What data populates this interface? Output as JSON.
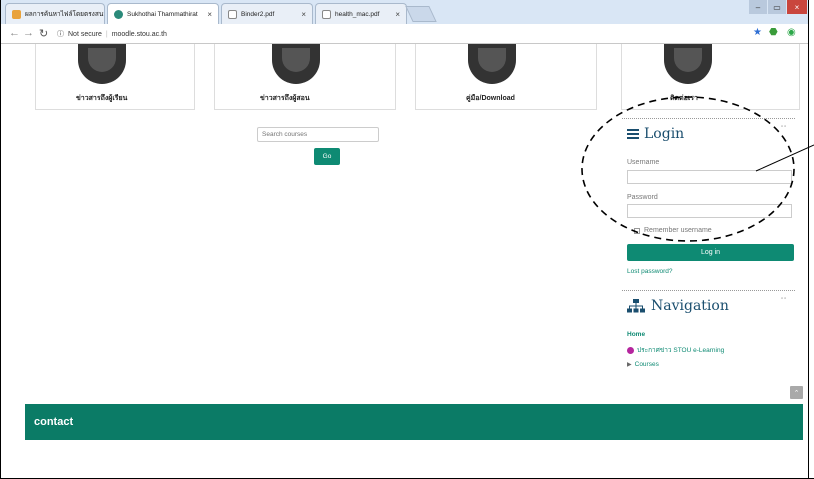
{
  "browser": {
    "tabs": [
      {
        "label": "ผลการค้นหาไฟล์โดยตรงสนามบิน"
      },
      {
        "label": "Sukhothai Thammathirat"
      },
      {
        "label": "Binder2.pdf"
      },
      {
        "label": "health_mac.pdf"
      }
    ],
    "address": {
      "security": "Not secure",
      "url": "moodle.stou.ac.th"
    },
    "icons": {
      "back": "back-arrow-icon",
      "forward": "forward-arrow-icon",
      "reload": "reload-icon",
      "info": "info-icon",
      "star": "star-icon"
    }
  },
  "cards": [
    {
      "label": "ข่าวสารถึงผู้เรียน"
    },
    {
      "label": "ข่าวสารถึงผู้สอน"
    },
    {
      "label": "คู่มือ/Download"
    },
    {
      "label": "ติดต่อเรา"
    }
  ],
  "search": {
    "placeholder": "Search courses",
    "go_label": "Go"
  },
  "login": {
    "title": "Login",
    "username_label": "Username",
    "password_label": "Password",
    "remember_label": "Remember username",
    "login_button": "Log in",
    "lost_password": "Lost password?"
  },
  "navigation": {
    "title": "Navigation",
    "items": [
      {
        "label": "Home"
      },
      {
        "label": "ประกาศข่าว STOU e-Learning"
      },
      {
        "label": "Courses"
      }
    ]
  },
  "footer": {
    "text": "contact"
  },
  "colors": {
    "accent": "#0e8a73",
    "footer": "#0b7b66",
    "title": "#1a4e6e"
  }
}
